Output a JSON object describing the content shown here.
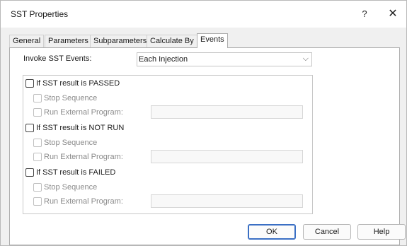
{
  "window": {
    "title": "SST Properties",
    "help_glyph": "?",
    "close_glyph": "✕"
  },
  "tabs": [
    {
      "label": "General"
    },
    {
      "label": "Parameters"
    },
    {
      "label": "Subparameters"
    },
    {
      "label": "Calculate By"
    },
    {
      "label": "Events",
      "active": true
    }
  ],
  "invoke": {
    "label": "Invoke SST Events:",
    "value": "Each Injection"
  },
  "passed": {
    "label": "If SST result is PASSED",
    "stop_label": "Stop Sequence",
    "run_label": "Run External Program:",
    "program_value": ""
  },
  "notrun": {
    "label": "If SST result is NOT RUN",
    "stop_label": "Stop Sequence",
    "run_label": "Run External Program:",
    "program_value": ""
  },
  "failed": {
    "label": "If SST result is FAILED",
    "stop_label": "Stop Sequence",
    "run_label": "Run External Program:",
    "program_value": ""
  },
  "buttons": {
    "ok": "OK",
    "cancel": "Cancel",
    "help": "Help"
  },
  "colors": {
    "default_button_border": "#3a6fc4",
    "panel_bg": "#ffffff",
    "dialog_bg": "#f0f0f0"
  }
}
